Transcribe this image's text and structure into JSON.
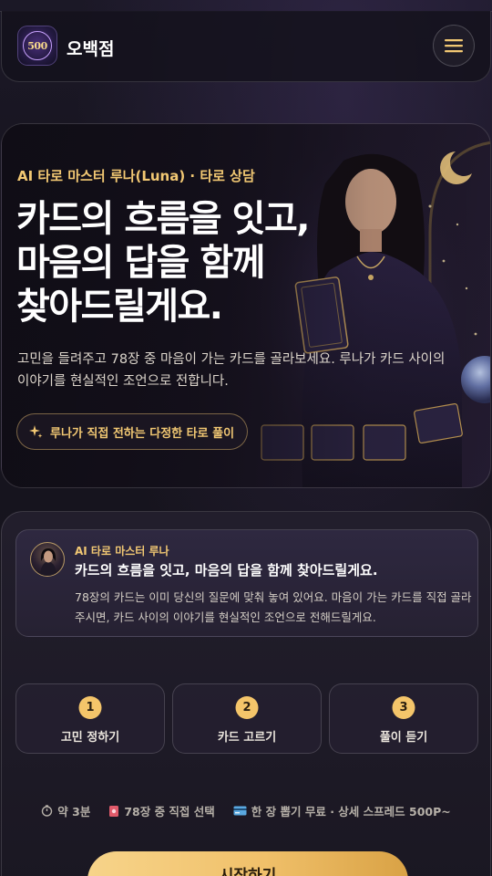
{
  "header": {
    "logo_text": "500",
    "brand": "오백점"
  },
  "hero": {
    "eyebrow": "AI 타로 마스터 루나(Luna) · 타로 상담",
    "title_lines": [
      "카드의 흐름을 잇고,",
      "마음의 답을 함께",
      "찾아드릴게요."
    ],
    "description": "고민을 들려주고 78장 중 마음이 가는 카드를 골라보세요. 루나가 카드 사이의 이야기를 현실적인 조언으로 전합니다.",
    "pill": "루나가 직접 전하는 다정한 타로 풀이"
  },
  "luna_card": {
    "label": "AI 타로 마스터 루나",
    "headline": "카드의 흐름을 잇고, 마음의 답을 함께 찾아드릴게요.",
    "body": "78장의 카드는 이미 당신의 질문에 맞춰 놓여 있어요. 마음이 가는 카드를 직접 골라주시면, 카드 사이의 이야기를 현실적인 조언으로 전해드릴게요."
  },
  "steps": [
    {
      "num": "1",
      "label": "고민 정하기"
    },
    {
      "num": "2",
      "label": "카드 고르기"
    },
    {
      "num": "3",
      "label": "풀이 듣기"
    }
  ],
  "meta": {
    "time": "약 3분",
    "cards": "78장 중 직접 선택",
    "price": "한 장 뽑기 무료 · 상세 스프레드 500P~"
  },
  "cta": {
    "label": "시작하기"
  },
  "colors": {
    "accent_gold": "#f2c873",
    "button_gold": "#f0c06a",
    "background": "#17151f"
  }
}
